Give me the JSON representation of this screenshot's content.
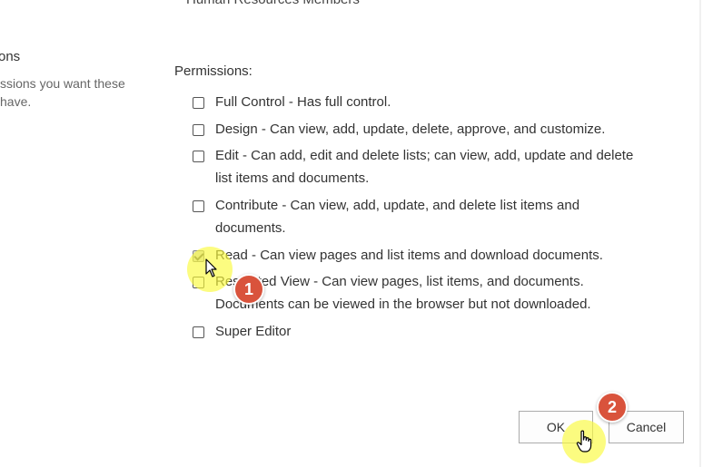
{
  "header": {
    "cropped_group_name": "Human Resources Members"
  },
  "left_panel": {
    "section_title": "ons",
    "description_line1": "ssions you want these",
    "description_line2": "have."
  },
  "permissions": {
    "label": "Permissions:",
    "items": [
      {
        "line1": "Full Control - Has full control.",
        "line2": "",
        "checked": false
      },
      {
        "line1": "Design - Can view, add, update, delete, approve, and customize.",
        "line2": "",
        "checked": false
      },
      {
        "line1": "Edit - Can add, edit and delete lists; can view, add, update and delete",
        "line2": "list items and documents.",
        "checked": false
      },
      {
        "line1": "Contribute - Can view, add, update, and delete list items and",
        "line2": "documents.",
        "checked": false
      },
      {
        "line1": "Read - Can view pages and list items and download documents.",
        "line2": "",
        "checked": true
      },
      {
        "line1": "Restricted View - Can view pages, list items, and documents.",
        "line2": "Documents can be viewed in the browser but not downloaded.",
        "checked": false
      },
      {
        "line1": "Super Editor",
        "line2": "",
        "checked": false
      }
    ]
  },
  "buttons": {
    "ok_label": "OK",
    "cancel_label": "Cancel"
  },
  "annotations": {
    "step1": "1",
    "step2": "2"
  },
  "colors": {
    "badge": "#d9533c",
    "highlight": "#fafa3c"
  }
}
